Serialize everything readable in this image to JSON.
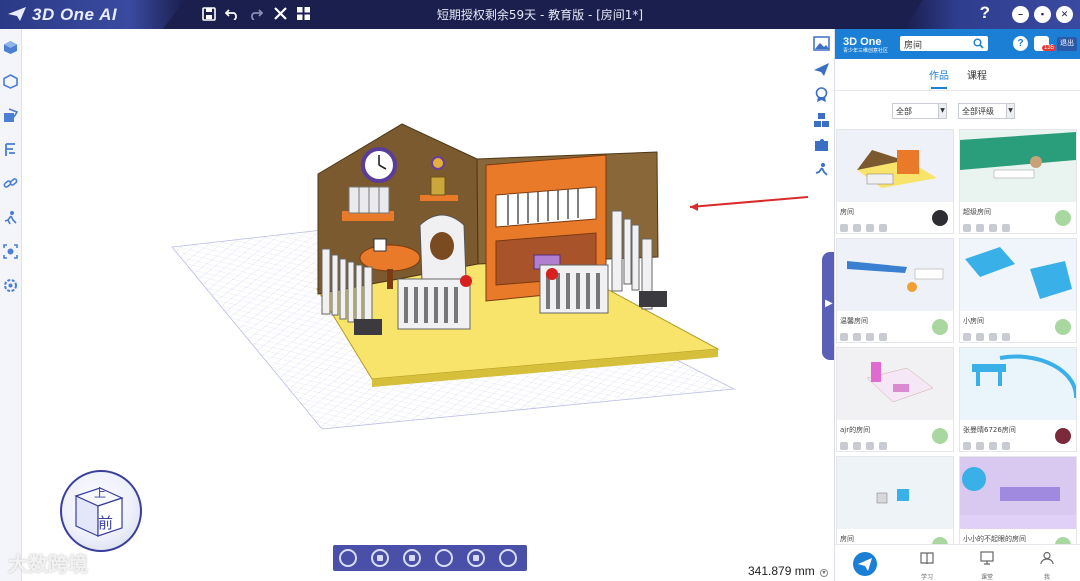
{
  "app": {
    "logo": "3D One AI",
    "title": "短期授权剩余59天 - 教育版 - [房间1*]"
  },
  "titlebar": {
    "icons": [
      "save-icon",
      "undo-icon",
      "redo-icon",
      "close-x-icon",
      "grid-icon"
    ],
    "help": "?"
  },
  "panel": {
    "logo": "3D One",
    "logo_sub": "青少年三维创意社区",
    "search_value": "房间",
    "message_count": "135",
    "exit_label": "退出",
    "tabs": [
      "作品",
      "课程"
    ],
    "active_tab": "作品",
    "filter_all": "全部",
    "filter_rating": "全部评级",
    "cards": [
      {
        "name": "房间",
        "thumb_bg": "#eef1f7"
      },
      {
        "name": "超级房间",
        "thumb_bg": "#e9f3ef"
      },
      {
        "name": "温馨房间",
        "thumb_bg": "#eef2f8"
      },
      {
        "name": "小房间",
        "thumb_bg": "#eff5fb"
      },
      {
        "name": "ajr的房间",
        "thumb_bg": "#f1f1f4"
      },
      {
        "name": "张曼晴6726房间",
        "thumb_bg": "#eaf4fb"
      },
      {
        "name": "房间",
        "thumb_bg": "#eef3f7"
      },
      {
        "name": "小小的不起眼的房间",
        "thumb_bg": "#d9c9f0"
      }
    ],
    "nav": [
      "学习",
      "课堂",
      "我"
    ]
  },
  "viewport": {
    "measurement": "341.879 mm",
    "viewcube_top": "上",
    "viewcube_front": "前"
  },
  "watermark": "大数跨境",
  "colors": {
    "titlebar": "#1a1f4e",
    "panel_header": "#1c7fd6",
    "playbar": "#4a4fa8",
    "floor": "#f8e46a",
    "wall": "#7a5a2e",
    "shelf": "#e87a2a"
  }
}
